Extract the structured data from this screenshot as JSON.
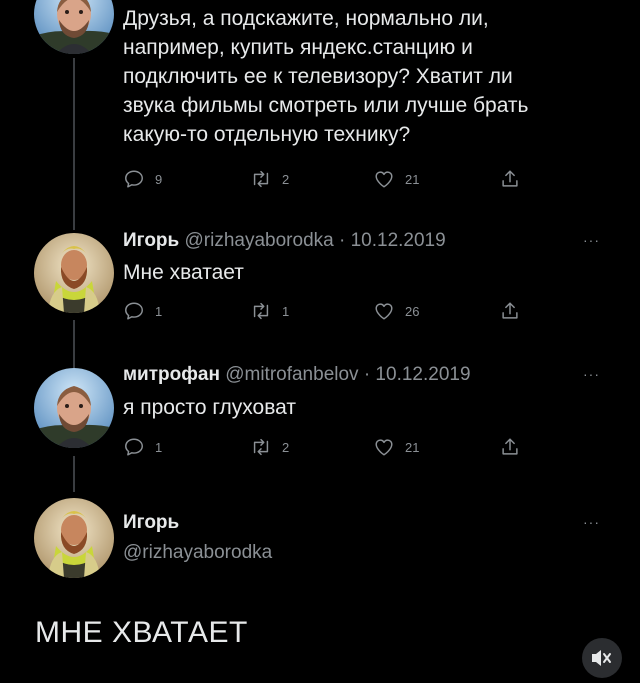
{
  "colors": {
    "background": "#000000",
    "text": "#e7e9ea",
    "muted": "#8b9095",
    "thread": "#3a3d41"
  },
  "tweets": [
    {
      "text": [
        "Друзья, а подскажите, нормально ли,",
        "например, купить яндекс.станцию и",
        "подключить ее к телевизору? Хватит ли",
        "звука фильмы смотреть или лучше брать",
        "какую-то отдельную технику?"
      ],
      "replies": "9",
      "retweets": "2",
      "likes": "21"
    },
    {
      "name": "Игорь",
      "handle": "@rizhayaborodka",
      "date": "· 10.12.2019",
      "text": "Мне хватает",
      "replies": "1",
      "retweets": "1",
      "likes": "26"
    },
    {
      "name": "митрофан",
      "handle": "@mitrofanbelov",
      "date": "· 10.12.2019",
      "text": "я просто глуховат",
      "replies": "1",
      "retweets": "2",
      "likes": "21"
    },
    {
      "name": "Игорь",
      "handle": "@rizhayaborodka"
    }
  ],
  "more_label": "···",
  "quote_text": "МНЕ ХВАТАЕТ",
  "icons": [
    "reply-icon",
    "retweet-icon",
    "like-icon",
    "share-icon",
    "more-icon",
    "volume-off-icon"
  ]
}
